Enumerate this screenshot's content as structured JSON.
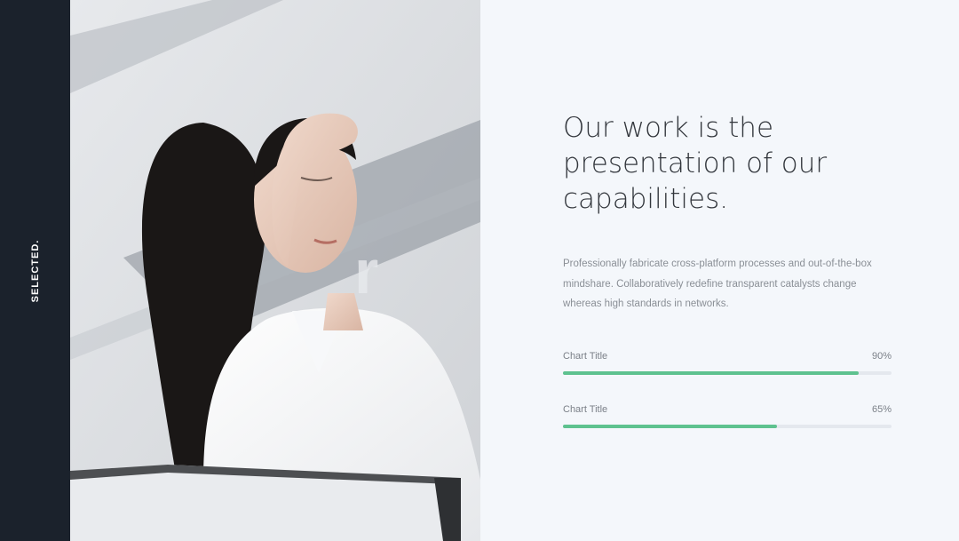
{
  "sidebar": {
    "label": "SELECTED."
  },
  "photo": {
    "subject": "woman-with-hand-on-forehead-photo"
  },
  "content": {
    "headline": "Our work is the presentation of our capabilities.",
    "description": "Professionally fabricate cross-platform processes and out-of-the-box mindshare. Collaboratively redefine transparent catalysts change whereas high standards in networks."
  },
  "skills": [
    {
      "title": "Chart Title",
      "percent_label": "90%",
      "value": 0.9
    },
    {
      "title": "Chart Title",
      "percent_label": "65%",
      "value": 0.65
    }
  ],
  "colors": {
    "sidebar": "#1b222c",
    "background": "#f4f7fb",
    "accent": "#5ec28f",
    "track": "#e4e8ee",
    "headline": "#33373d"
  }
}
